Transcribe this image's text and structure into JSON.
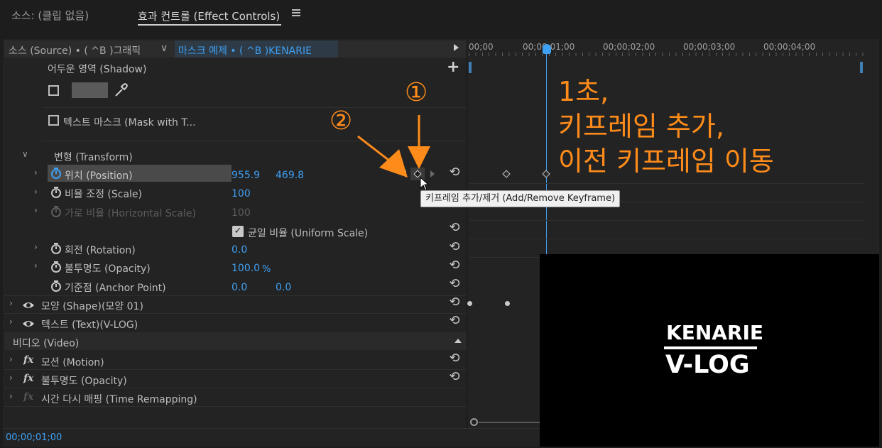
{
  "tabs": {
    "source": "소스: (클립 없음)",
    "effect_controls": "효과 컨트롤 (Effect Controls)",
    "menu_icon": "hamburger-icon"
  },
  "header": {
    "source_clip": "소스 (Source) • ( ^B )그래픽",
    "sequence_clip": "마스크 예제 • ( ^B )KENARIE"
  },
  "timecodes": [
    "00;00",
    "00;00;01;00",
    "00;00;02;00",
    "00;00;03;00",
    "00;00;04;00"
  ],
  "shadow": {
    "label": "어두운 영역 (Shadow)"
  },
  "mask_text": {
    "label": "텍스트 마스크 (Mask with T..."
  },
  "transform": {
    "label": "변형 (Transform)",
    "position": {
      "label": "위치 (Position)",
      "x": "955.9",
      "y": "469.8"
    },
    "scale": {
      "label": "비율 조정 (Scale)",
      "value": "100"
    },
    "hscale": {
      "label": "가로 비율 (Horizontal Scale)",
      "value": "100"
    },
    "uniform": {
      "label": "균일 비율 (Uniform Scale)",
      "checked": true
    },
    "rotation": {
      "label": "회전 (Rotation)",
      "value": "0.0"
    },
    "opacity": {
      "label": "불투명도 (Opacity)",
      "value": "100.0",
      "unit": "%"
    },
    "anchor": {
      "label": "기준점 (Anchor Point)",
      "x": "0.0",
      "y": "0.0"
    }
  },
  "shape": {
    "label": "모양 (Shape)(모양 01)"
  },
  "text": {
    "label": "텍스트 (Text)(V-LOG)"
  },
  "video": {
    "label": "비디오 (Video)"
  },
  "motion": {
    "label": "모션 (Motion)"
  },
  "opacity_fx": {
    "label": "불투명도 (Opacity)"
  },
  "time_remap": {
    "label": "시간 다시 매핑 (Time Remapping)"
  },
  "tooltip": "키프레임 추가/제거 (Add/Remove Keyframe)",
  "annotation": {
    "circle1": "①",
    "circle2": "②",
    "line1": "1초,",
    "line2": "키프레임 추가,",
    "line3": "이전 키프레임 이동"
  },
  "preview": {
    "title": "KENARIE",
    "subtitle": "V-LOG"
  },
  "current_time": "00;00;01;00",
  "colors": {
    "accent_blue": "#3f9ff2",
    "annotation_orange": "#ff8c1a"
  }
}
